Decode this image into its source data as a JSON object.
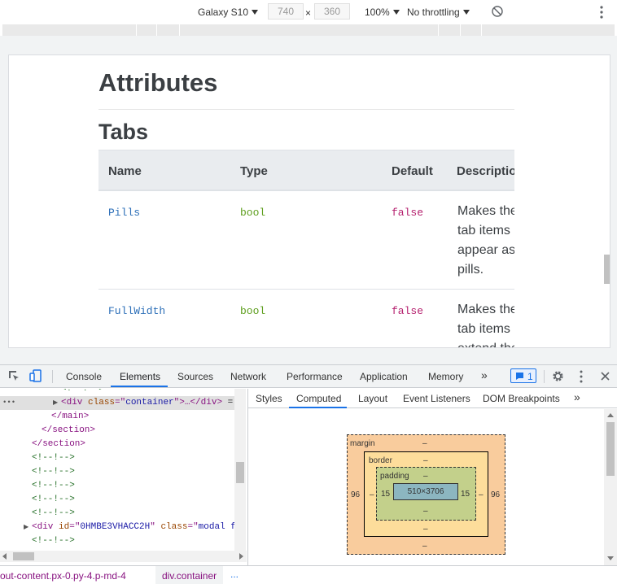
{
  "device_toolbar": {
    "device": "Galaxy S10",
    "width": "740",
    "height": "360",
    "times": "×",
    "zoom": "100%",
    "throttling": "No throttling"
  },
  "page": {
    "heading_attributes": "Attributes",
    "heading_tabs": "Tabs",
    "table": {
      "headers": [
        "Name",
        "Type",
        "Default",
        "Descriptio"
      ],
      "rows": [
        {
          "name": "Pills",
          "type": "bool",
          "default": "false",
          "desc": [
            "Makes the",
            "tab items",
            "appear as",
            "pills."
          ]
        },
        {
          "name": "FullWidth",
          "type": "bool",
          "default": "false",
          "desc": [
            "Makes the",
            "tab items",
            "extend the"
          ]
        }
      ]
    }
  },
  "devtools": {
    "tabs": [
      "Console",
      "Elements",
      "Sources",
      "Network",
      "Performance",
      "Application",
      "Memory"
    ],
    "more": "»",
    "message_count": "1",
    "elements": {
      "lines": [
        {
          "indent": 75,
          "parts": [
            [
              "comment",
              "<!--!-->"
            ]
          ]
        },
        {
          "indent": 75,
          "selected": true,
          "arrow": "▶",
          "parts": [
            [
              "tag",
              "<div "
            ],
            [
              "attrn",
              "class"
            ],
            [
              "tag",
              "=\""
            ],
            [
              "attrv",
              "container"
            ],
            [
              "tag",
              "\">…</div>"
            ],
            [
              "plain",
              " ="
            ]
          ]
        },
        {
          "indent": 63,
          "parts": [
            [
              "tag",
              "</main>"
            ]
          ]
        },
        {
          "indent": 51,
          "parts": [
            [
              "tag",
              "</section>"
            ]
          ]
        },
        {
          "indent": 39,
          "parts": [
            [
              "tag",
              "</section>"
            ]
          ]
        },
        {
          "indent": 39,
          "parts": [
            [
              "comment",
              "<!--!-->"
            ]
          ]
        },
        {
          "indent": 39,
          "parts": [
            [
              "comment",
              "<!--!-->"
            ]
          ]
        },
        {
          "indent": 39,
          "parts": [
            [
              "comment",
              "<!--!-->"
            ]
          ]
        },
        {
          "indent": 39,
          "parts": [
            [
              "comment",
              "<!--!-->"
            ]
          ]
        },
        {
          "indent": 39,
          "parts": [
            [
              "comment",
              "<!--!-->"
            ]
          ]
        },
        {
          "indent": 39,
          "arrow": "▶",
          "parts": [
            [
              "tag",
              "<div "
            ],
            [
              "attrn",
              "id"
            ],
            [
              "tag",
              "=\""
            ],
            [
              "attrv",
              "0HMBE3VHACC2H"
            ],
            [
              "tag",
              "\" "
            ],
            [
              "attrn",
              "class"
            ],
            [
              "tag",
              "=\""
            ],
            [
              "attrv",
              "modal f"
            ]
          ]
        },
        {
          "indent": 39,
          "parts": [
            [
              "comment",
              "<!--!-->"
            ]
          ]
        }
      ],
      "ellipsis": "•••"
    },
    "breadcrumbs": [
      "out-content.px-0.py-4.p-md-4",
      "div.container",
      "..."
    ],
    "side_tabs": [
      "Styles",
      "Computed",
      "Layout",
      "Event Listeners",
      "DOM Breakpoints"
    ],
    "side_more": "»",
    "box_model": {
      "margin_label": "margin",
      "border_label": "border",
      "padding_label": "padding",
      "dash": "–",
      "margin_left": "96",
      "margin_right": "96",
      "padding_left": "15",
      "padding_right": "15",
      "content": "510×3706"
    }
  }
}
